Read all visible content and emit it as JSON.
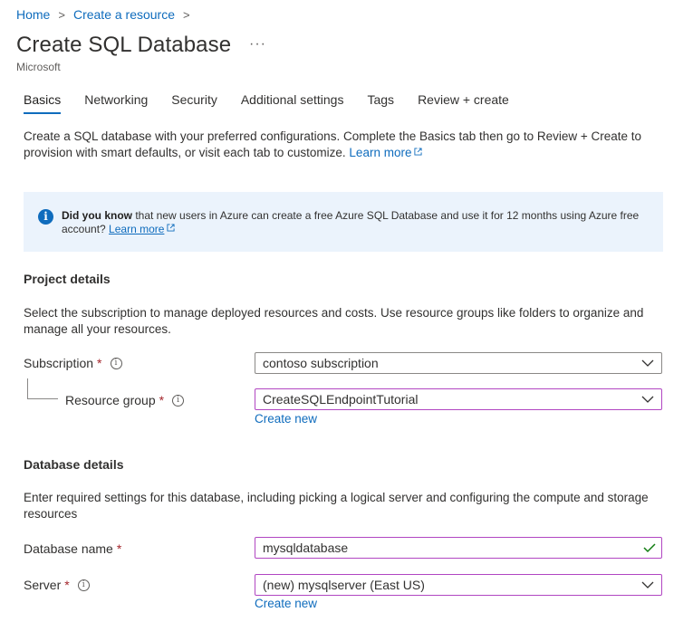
{
  "breadcrumb": {
    "home": "Home",
    "create": "Create a resource"
  },
  "page": {
    "title": "Create SQL Database",
    "more": "···",
    "publisher": "Microsoft"
  },
  "tabs": [
    "Basics",
    "Networking",
    "Security",
    "Additional settings",
    "Tags",
    "Review + create"
  ],
  "intro": {
    "text": "Create a SQL database with your preferred configurations. Complete the Basics tab then go to Review + Create to provision with smart defaults, or visit each tab to customize.",
    "learn_more": "Learn more"
  },
  "banner": {
    "bold": "Did you know",
    "text": " that new users in Azure can create a free Azure SQL Database and use it for 12 months using Azure free account?",
    "learn_more": "Learn more"
  },
  "project": {
    "heading": "Project details",
    "description": "Select the subscription to manage deployed resources and costs. Use resource groups like folders to organize and manage all your resources.",
    "subscription": {
      "label": "Subscription",
      "required": "*",
      "value": "contoso subscription"
    },
    "resource_group": {
      "label": "Resource group",
      "required": "*",
      "value": "CreateSQLEndpointTutorial",
      "create_new": "Create new"
    }
  },
  "database": {
    "heading": "Database details",
    "description": "Enter required settings for this database, including picking a logical server and configuring the compute and storage resources",
    "name": {
      "label": "Database name",
      "required": "*",
      "value": "mysqldatabase"
    },
    "server": {
      "label": "Server",
      "required": "*",
      "value": "(new) mysqlserver (East US)",
      "create_new": "Create new"
    }
  },
  "icons": {
    "info": "info-icon",
    "chevron": "chevron-down-icon",
    "check": "checkmark-icon",
    "external": "external-link-icon"
  },
  "colors": {
    "accent": "#0f6cbd",
    "banner_bg": "#ebf3fc",
    "required": "#a4262c",
    "focus_border": "#b146c2"
  }
}
